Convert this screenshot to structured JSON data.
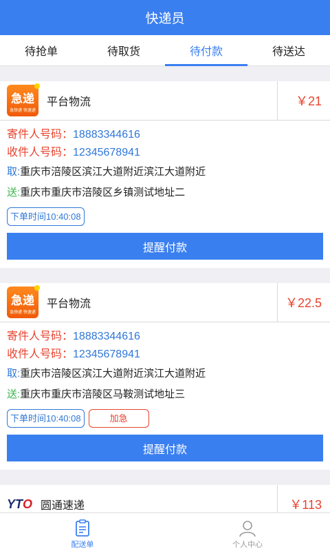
{
  "header": {
    "title": "快递员"
  },
  "tabs": [
    {
      "label": "待抢单"
    },
    {
      "label": "待取货"
    },
    {
      "label": "待付款"
    },
    {
      "label": "待送达"
    }
  ],
  "orders": [
    {
      "company": "平台物流",
      "price": "￥21",
      "logo_text": "急递",
      "logo_sub": "急快递 快速递",
      "sender_label": "寄件人号码：",
      "sender_phone": "18883344616",
      "receiver_label": "收件人号码：",
      "receiver_phone": "12345678941",
      "pickup_tag": "取:",
      "pickup_addr": "重庆市涪陵区滨江大道附近滨江大道附近",
      "deliver_tag": "送:",
      "deliver_addr": "重庆市重庆市涪陵区乡镇测试地址二",
      "order_time": "下单时间10:40:08",
      "action_label": "提醒付款"
    },
    {
      "company": "平台物流",
      "price": "￥22.5",
      "logo_text": "急递",
      "logo_sub": "急快递 快速递",
      "sender_label": "寄件人号码：",
      "sender_phone": "18883344616",
      "receiver_label": "收件人号码：",
      "receiver_phone": "12345678941",
      "pickup_tag": "取:",
      "pickup_addr": "重庆市涪陵区滨江大道附近滨江大道附近",
      "deliver_tag": "送:",
      "deliver_addr": "重庆市重庆市涪陵区马鞍测试地址三",
      "order_time": "下单时间10:40:08",
      "urgent": "加急",
      "action_label": "提醒付款"
    },
    {
      "company": "圆通速递",
      "price": "￥113",
      "logo_text_y": "YT",
      "logo_text_t": "O"
    }
  ],
  "bottom_nav": [
    {
      "label": "配送单",
      "icon": "clipboard-icon"
    },
    {
      "label": "个人中心",
      "icon": "user-icon"
    }
  ],
  "colors": {
    "primary": "#3a7ff0",
    "price": "#e8432e",
    "link": "#2f77d8",
    "green": "#3ab54a"
  }
}
